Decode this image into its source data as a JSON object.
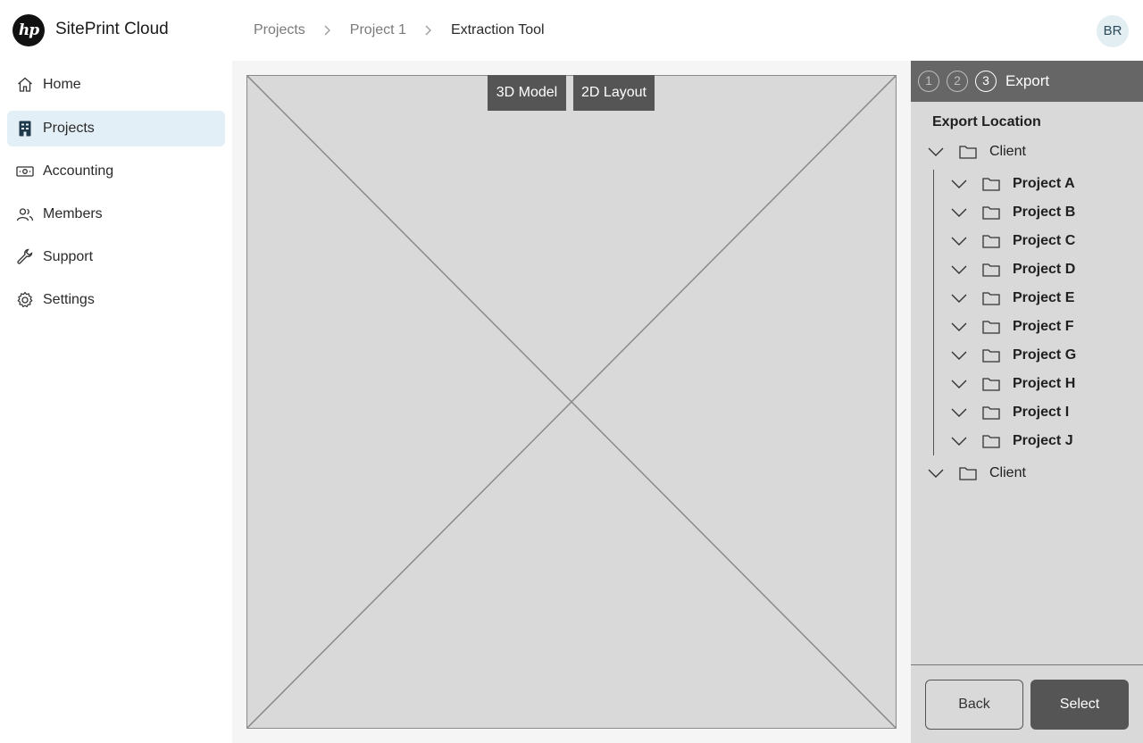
{
  "app": {
    "logo_text": "hp",
    "title": "SitePrint Cloud"
  },
  "breadcrumb": [
    "Projects",
    "Project 1",
    "Extraction Tool"
  ],
  "user": {
    "initials": "BR"
  },
  "sidebar": {
    "items": [
      {
        "label": "Home",
        "icon": "home-icon",
        "active": false
      },
      {
        "label": "Projects",
        "icon": "projects-icon",
        "active": true
      },
      {
        "label": "Accounting",
        "icon": "accounting-icon",
        "active": false
      },
      {
        "label": "Members",
        "icon": "members-icon",
        "active": false
      },
      {
        "label": "Support",
        "icon": "wrench-icon",
        "active": false
      },
      {
        "label": "Settings",
        "icon": "gear-icon",
        "active": false
      }
    ]
  },
  "viewer": {
    "toggle_3d": "3D Model",
    "toggle_2d": "2D Layout"
  },
  "panel": {
    "steps": [
      "1",
      "2",
      "3"
    ],
    "current_step_label": "Export",
    "section_label": "Export Location",
    "tree": {
      "root_1": "Client",
      "children": [
        "Project A",
        "Project B",
        "Project C",
        "Project D",
        "Project E",
        "Project F",
        "Project G",
        "Project H",
        "Project I",
        "Project J"
      ],
      "root_2": "Client"
    },
    "back_label": "Back",
    "select_label": "Select"
  },
  "colors": {
    "panel_header": "#666666",
    "button_dark": "#555555",
    "active_nav": "#e3eff6",
    "placeholder": "#d9d9d9"
  }
}
